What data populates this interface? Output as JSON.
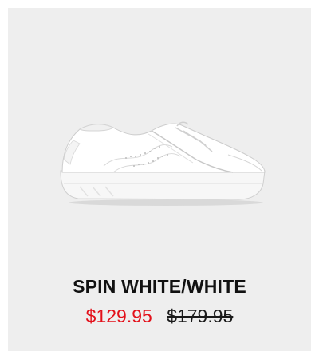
{
  "product": {
    "name": "SPIN WHITE/WHITE",
    "sale_price": "$129.95",
    "original_price": "$179.95",
    "image": {
      "icon": "white-sneaker-image"
    }
  },
  "colors": {
    "card_background": "#eeeeee",
    "sale_price": "#e3101a",
    "original_price": "#1a1a1a",
    "title": "#111111"
  }
}
